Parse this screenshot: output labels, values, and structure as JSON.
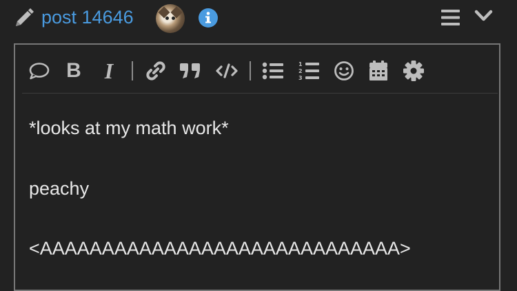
{
  "header": {
    "post_link": "post 14646",
    "icons": {
      "edit": "pencil-icon",
      "info": "info-icon",
      "menu": "hamburger-menu-icon",
      "collapse": "chevron-down-icon"
    },
    "colors": {
      "link": "#4a9be0",
      "info": "#4a9be0",
      "icon_gray": "#bdbdbd"
    }
  },
  "toolbar": {
    "buttons": [
      {
        "name": "speech-bubble-icon"
      },
      {
        "name": "bold-button",
        "glyph": "B"
      },
      {
        "name": "italic-button",
        "glyph": "I"
      },
      {
        "name": "link-icon"
      },
      {
        "name": "quote-icon"
      },
      {
        "name": "code-icon"
      },
      {
        "name": "bullet-list-icon"
      },
      {
        "name": "numbered-list-icon"
      },
      {
        "name": "emoji-icon"
      },
      {
        "name": "calendar-icon"
      },
      {
        "name": "gear-icon"
      }
    ]
  },
  "editor": {
    "lines": [
      "*looks at my math work*",
      "peachy",
      "<AAAAAAAAAAAAAAAAAAAAAAAAAAAAA>"
    ],
    "colors": {
      "text": "#e8e8e8",
      "border": "#777777",
      "background": "#222222"
    }
  }
}
